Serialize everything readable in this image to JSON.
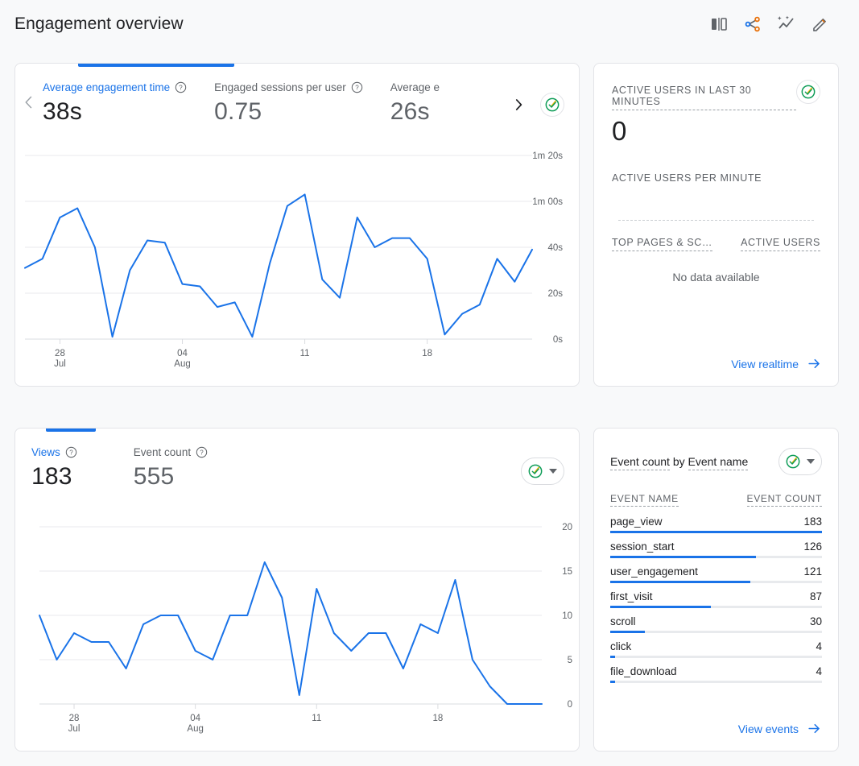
{
  "header": {
    "title": "Engagement overview",
    "actions": [
      {
        "name": "compare-icon",
        "label": "Compare"
      },
      {
        "name": "share-icon",
        "label": "Share this report"
      },
      {
        "name": "insights-icon",
        "label": "Insights"
      },
      {
        "name": "edit-icon",
        "label": "Edit"
      }
    ]
  },
  "colors": {
    "accent": "#1a73e8",
    "line": "#1a73e8",
    "check_green": "#0f9d58",
    "check_gold": "#f4b400",
    "text_primary": "#202124",
    "text_secondary": "#5f6368",
    "grid": "#e8eaed",
    "card_border": "#e3e4e8",
    "page_bg": "#f8f9fa"
  },
  "engagement_card": {
    "prev_label": "Previous metrics",
    "next_label": "Next metrics",
    "active_index": 0,
    "metrics": [
      {
        "label": "Average engagement time",
        "value": "38s",
        "help": "?"
      },
      {
        "label": "Engaged sessions per user",
        "value": "0.75",
        "help": "?"
      },
      {
        "label": "Average e",
        "value": "26s",
        "help": "?"
      }
    ],
    "status_badge": "check-circle"
  },
  "realtime_card": {
    "heading": "ACTIVE USERS IN LAST 30 MINUTES",
    "value": "0",
    "subheading": "ACTIVE USERS PER MINUTE",
    "col_left": "TOP PAGES & SC…",
    "col_right": "ACTIVE USERS",
    "no_data": "No data available",
    "link": "View realtime",
    "status_badge": "check-circle"
  },
  "views_card": {
    "active_index": 0,
    "metrics": [
      {
        "label": "Views",
        "value": "183",
        "help": "?"
      },
      {
        "label": "Event count",
        "value": "555",
        "help": "?"
      }
    ],
    "status_badge": "check-circle"
  },
  "events_card": {
    "title_part1": "Event count",
    "title_by": "by",
    "title_part2": "Event name",
    "col_name": "EVENT NAME",
    "col_count": "EVENT COUNT",
    "link": "View events",
    "status_badge": "check-circle",
    "rows": [
      {
        "name": "page_view",
        "count": "183",
        "pct": 100
      },
      {
        "name": "session_start",
        "count": "126",
        "pct": 68.9
      },
      {
        "name": "user_engagement",
        "count": "121",
        "pct": 66.1
      },
      {
        "name": "first_visit",
        "count": "87",
        "pct": 47.5
      },
      {
        "name": "scroll",
        "count": "30",
        "pct": 16.4
      },
      {
        "name": "click",
        "count": "4",
        "pct": 2.2
      },
      {
        "name": "file_download",
        "count": "4",
        "pct": 2.2
      }
    ]
  },
  "chart_data": [
    {
      "id": "engagement-time-chart",
      "type": "line",
      "title": "Average engagement time",
      "xlabel": "",
      "ylabel": "",
      "grid": true,
      "legend": false,
      "ytick_labels": [
        "1m 20s",
        "1m 00s",
        "40s",
        "20s",
        "0s"
      ],
      "ytick_values": [
        80,
        60,
        40,
        20,
        0
      ],
      "ylim": [
        0,
        80
      ],
      "xtick_labels": [
        "28\nJul",
        "04\nAug",
        "11",
        "18"
      ],
      "xtick_indices": [
        2,
        9,
        16,
        23
      ],
      "x": [
        0,
        1,
        2,
        3,
        4,
        5,
        6,
        7,
        8,
        9,
        10,
        11,
        12,
        13,
        14,
        15,
        16,
        17,
        18,
        19,
        20,
        21,
        22,
        23,
        24,
        25,
        26,
        27,
        28,
        29
      ],
      "values": [
        31,
        35,
        53,
        57,
        40,
        1,
        30,
        43,
        42,
        24,
        23,
        14,
        16,
        1,
        33,
        58,
        63,
        26,
        18,
        53,
        40,
        44,
        44,
        35,
        2,
        11,
        15,
        35,
        25,
        39
      ]
    },
    {
      "id": "views-chart",
      "type": "line",
      "title": "Views",
      "xlabel": "",
      "ylabel": "",
      "grid": true,
      "legend": false,
      "ytick_labels": [
        "20",
        "15",
        "10",
        "5",
        "0"
      ],
      "ytick_values": [
        20,
        15,
        10,
        5,
        0
      ],
      "ylim": [
        0,
        20
      ],
      "xtick_labels": [
        "28\nJul",
        "04\nAug",
        "11",
        "18"
      ],
      "xtick_indices": [
        2,
        9,
        16,
        23
      ],
      "x": [
        0,
        1,
        2,
        3,
        4,
        5,
        6,
        7,
        8,
        9,
        10,
        11,
        12,
        13,
        14,
        15,
        16,
        17,
        18,
        19,
        20,
        21,
        22,
        23,
        24,
        25,
        26,
        27,
        28,
        29
      ],
      "values": [
        10,
        5,
        8,
        7,
        7,
        4,
        9,
        10,
        10,
        6,
        5,
        10,
        10,
        16,
        12,
        1,
        13,
        8,
        6,
        8,
        8,
        4,
        9,
        8,
        14,
        5,
        2,
        0,
        0,
        0
      ]
    }
  ]
}
